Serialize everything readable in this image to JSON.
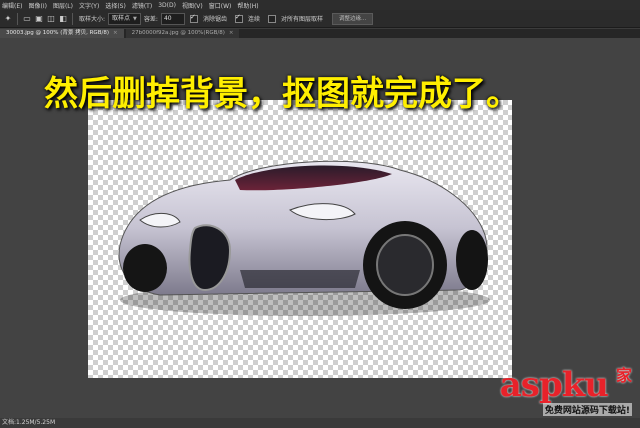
{
  "menubar": {
    "items": [
      "编辑(E)",
      "图像(I)",
      "图层(L)",
      "文字(Y)",
      "选择(S)",
      "滤镜(T)",
      "3D(D)",
      "视图(V)",
      "窗口(W)",
      "帮助(H)"
    ]
  },
  "options": {
    "sample_size_label": "取样大小:",
    "sample_size_value": "取样点",
    "tolerance_label": "容差:",
    "tolerance_value": "40",
    "antialias_label": "消除锯齿",
    "contiguous_label": "连续",
    "all_layers_label": "对所有图层取样",
    "refine_edge_label": "调整边缘..."
  },
  "tabs": [
    {
      "label": "30003.jpg @ 100% (背景 拷贝, RGB/8)",
      "active": true
    },
    {
      "label": "27b0000f92a.jpg @ 100%(RGB/8)",
      "active": false
    }
  ],
  "caption": "然后删掉背景，抠图就完成了。",
  "status": {
    "doc_size": "文档:1.25M/5.25M"
  },
  "watermark": {
    "main": "aspku",
    "badge": "家",
    "sub": "免费网站源码下载站!"
  },
  "colors": {
    "caption": "#ffef00",
    "watermark": "#e8222a"
  }
}
